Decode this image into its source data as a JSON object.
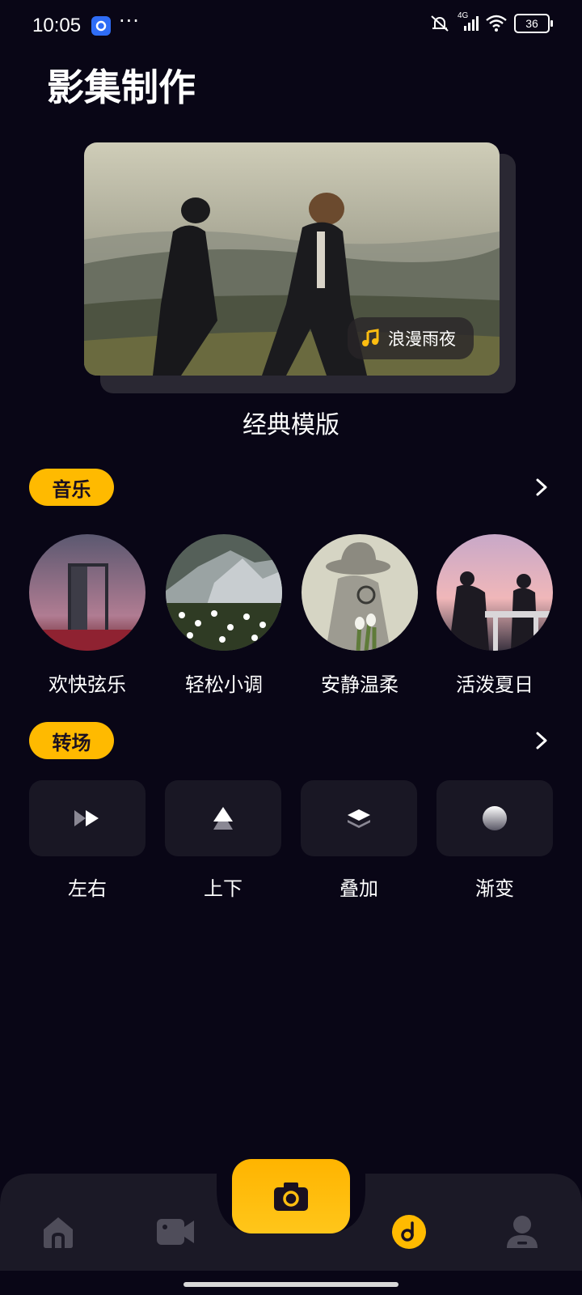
{
  "status": {
    "time": "10:05",
    "network": "4G",
    "battery": "36"
  },
  "page": {
    "title": "影集制作"
  },
  "featured": {
    "music_chip": "浪漫雨夜",
    "caption": "经典模版"
  },
  "music": {
    "label": "音乐",
    "items": [
      {
        "name": "欢快弦乐"
      },
      {
        "name": "轻松小调"
      },
      {
        "name": "安静温柔"
      },
      {
        "name": "活泼夏日"
      }
    ]
  },
  "transition": {
    "label": "转场",
    "items": [
      {
        "name": "左右",
        "icon": "fast-forward-icon"
      },
      {
        "name": "上下",
        "icon": "arrow-up-icon"
      },
      {
        "name": "叠加",
        "icon": "layers-icon"
      },
      {
        "name": "渐变",
        "icon": "gradient-sphere-icon"
      }
    ]
  },
  "nav": {
    "items": [
      {
        "icon": "home-icon"
      },
      {
        "icon": "video-camera-icon"
      },
      {
        "icon": "camera-icon"
      },
      {
        "icon": "music-disc-icon"
      },
      {
        "icon": "profile-icon"
      }
    ]
  },
  "colors": {
    "accent": "#ffba00",
    "background": "#090616",
    "tile": "#191724"
  }
}
